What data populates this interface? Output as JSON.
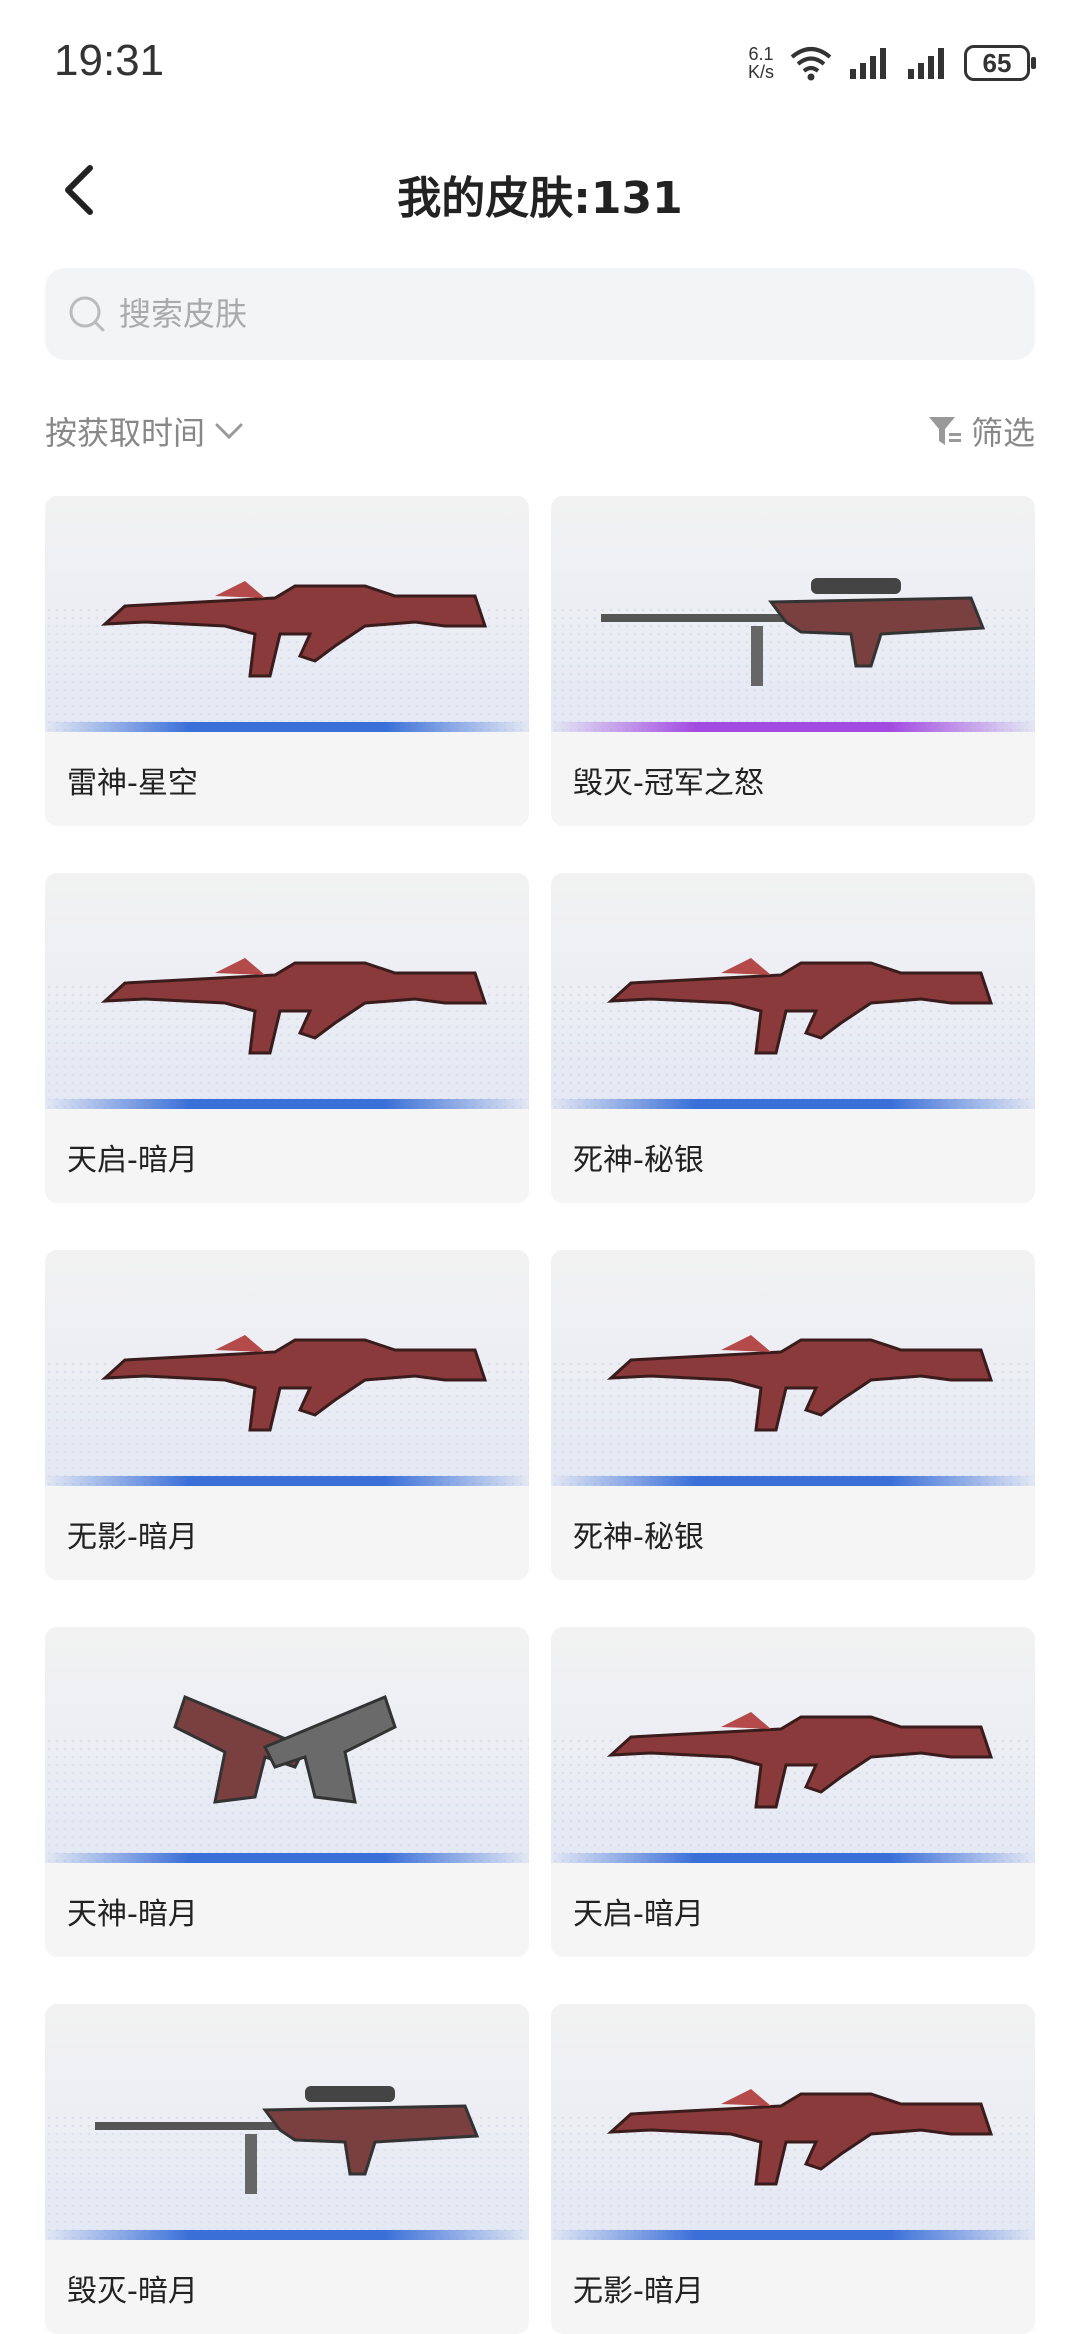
{
  "status": {
    "time": "19:31",
    "speed_top": "6.1",
    "speed_bottom": "K/s",
    "battery": "65"
  },
  "header": {
    "title": "我的皮肤:131"
  },
  "search": {
    "placeholder": "搜索皮肤"
  },
  "toolbar": {
    "sort_label": "按获取时间",
    "filter_label": "筛选"
  },
  "colors": {
    "blue_bar": "#3a6fd8",
    "purple_bar": "#a24be0"
  },
  "skins": [
    {
      "name": "雷神-星空",
      "rarity": "blue",
      "icon": "rifle-icon"
    },
    {
      "name": "毁灭-冠军之怒",
      "rarity": "purple",
      "icon": "sniper-icon"
    },
    {
      "name": "天启-暗月",
      "rarity": "blue",
      "icon": "rifle-icon"
    },
    {
      "name": "死神-秘银",
      "rarity": "blue",
      "icon": "rifle-icon"
    },
    {
      "name": "无影-暗月",
      "rarity": "blue",
      "icon": "rifle-icon"
    },
    {
      "name": "死神-秘银",
      "rarity": "blue",
      "icon": "rifle-icon"
    },
    {
      "name": "天神-暗月",
      "rarity": "blue",
      "icon": "pistol-icon"
    },
    {
      "name": "天启-暗月",
      "rarity": "blue",
      "icon": "rifle-icon"
    },
    {
      "name": "毁灭-暗月",
      "rarity": "blue",
      "icon": "sniper-icon"
    },
    {
      "name": "无影-暗月",
      "rarity": "blue",
      "icon": "rifle-icon"
    }
  ]
}
